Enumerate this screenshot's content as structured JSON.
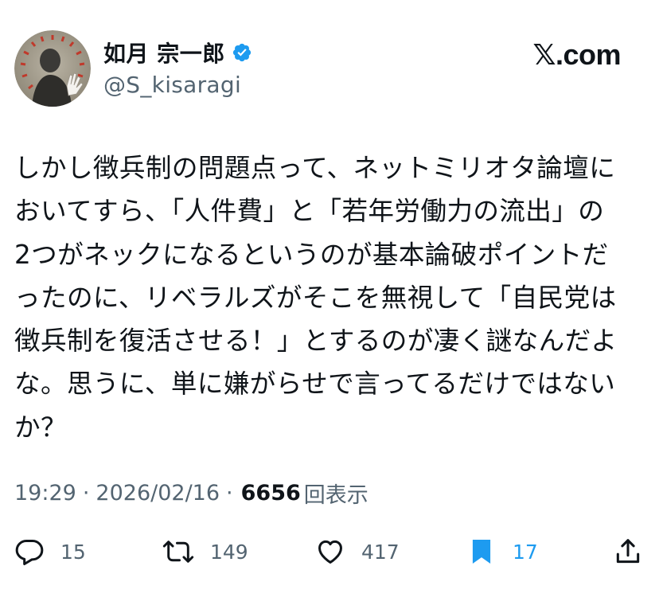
{
  "user": {
    "display_name": "如月 宗一郎",
    "handle": "@S_kisaragi",
    "verified": true
  },
  "brand": {
    "x_glyph": "𝕏",
    "domain": ".com"
  },
  "tweet": {
    "lines": [
      "しかし徴兵制の問題点って、ネットミリオタ論壇に",
      "おいてすら、「人件費」と「若年労働力の流出」の",
      "2つがネックになるというのが基本論破ポイントだ",
      "ったのに、リベラルズがそこを無視して「自民党は",
      "徴兵制を復活させる！」とするのが凄く謎なんだよ",
      "な。思うに、単に嫌がらせで言ってるだけではない",
      "か？"
    ]
  },
  "meta": {
    "time": "19:29",
    "separator": "·",
    "date": "2026/02/16",
    "views_count": "6656",
    "views_label": "回表示"
  },
  "actions": {
    "replies": "15",
    "reposts": "149",
    "likes": "417",
    "bookmarks": "17"
  },
  "colors": {
    "text": "#0f1419",
    "secondary": "#536471",
    "accent": "#1d9bf0"
  },
  "icons": {
    "reply": "speech-bubble-icon",
    "repost": "repost-arrows-icon",
    "like": "heart-icon",
    "bookmark": "bookmark-icon",
    "share": "share-upload-icon",
    "verified": "verified-badge-icon"
  }
}
